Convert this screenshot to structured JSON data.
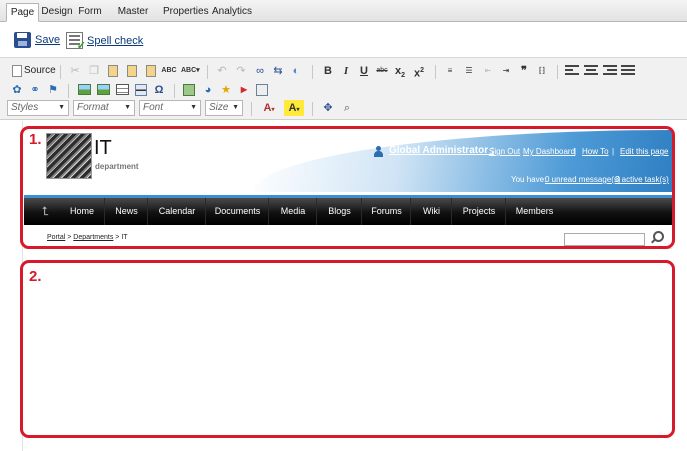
{
  "tabs": [
    "Page",
    "Design",
    "Form",
    "Master page",
    "Properties",
    "Analytics"
  ],
  "actions": {
    "save": "Save",
    "spell": "Spell check"
  },
  "editor": {
    "source_label": "Source",
    "styles": "Styles",
    "format": "Format",
    "font": "Font",
    "size": "Size"
  },
  "site": {
    "title": "IT",
    "subtitle": "department",
    "user_name": "Global Administrator :",
    "header_links": [
      "Sign Out",
      "My Dashboard",
      "How To",
      "Edit this page"
    ],
    "info_prefix": "You have:",
    "unread": "0 unread message(s)",
    "tasks": "3 active task(s)",
    "nav": [
      "Home",
      "News",
      "Calendar",
      "Documents",
      "Media",
      "Blogs",
      "Forums",
      "Wiki",
      "Projects",
      "Members"
    ],
    "breadcrumb": {
      "portal": "Portal",
      "sep1": " > ",
      "departments": "Departments",
      "sep2": " > ",
      "current": "IT"
    }
  },
  "annotations": [
    "1.",
    "2."
  ],
  "colors": {
    "accent_red": "#d7192c",
    "nav_blue": "#3d8fd4",
    "link_blue": "#0a3a7a"
  }
}
